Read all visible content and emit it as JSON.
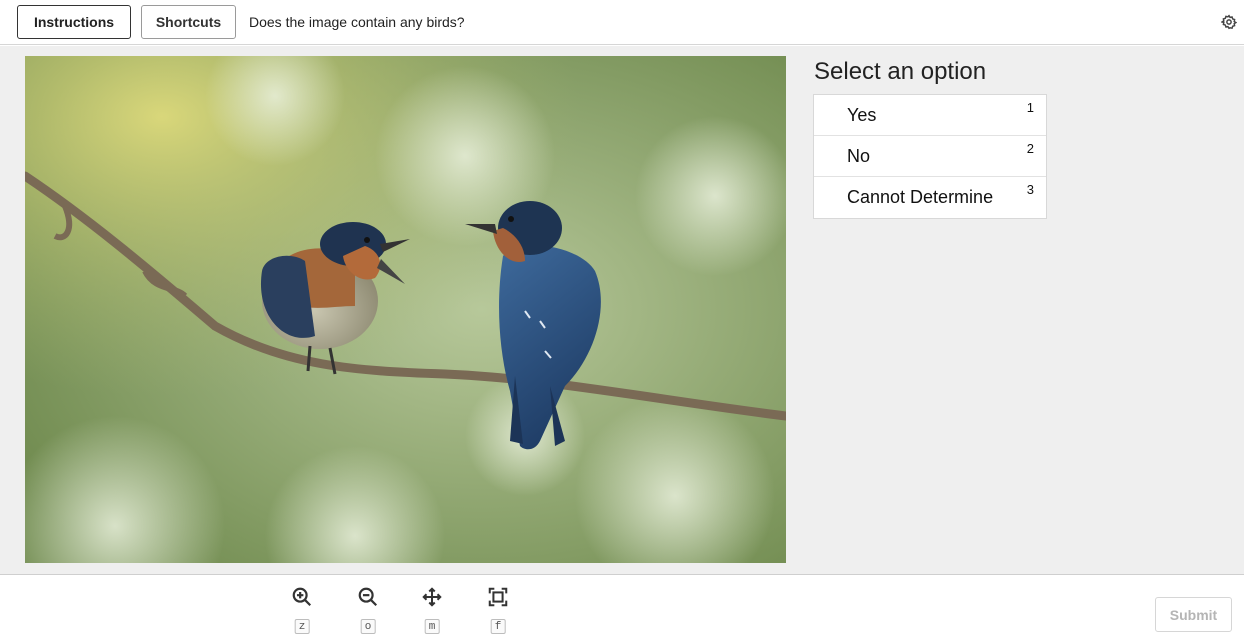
{
  "header": {
    "instructions_label": "Instructions",
    "shortcuts_label": "Shortcuts",
    "question": "Does the image contain any birds?"
  },
  "panel": {
    "title": "Select an option",
    "options": [
      {
        "label": "Yes",
        "key": "1"
      },
      {
        "label": "No",
        "key": "2"
      },
      {
        "label": "Cannot Determine",
        "key": "3"
      }
    ]
  },
  "toolbar": {
    "tools": [
      {
        "icon": "zoom-in-icon",
        "key": "z"
      },
      {
        "icon": "zoom-out-icon",
        "key": "o"
      },
      {
        "icon": "move-icon",
        "key": "m"
      },
      {
        "icon": "fit-screen-icon",
        "key": "f"
      }
    ],
    "submit_label": "Submit"
  },
  "colors": {
    "main_background": "#efefef",
    "submit_disabled_text": "#b5b5b5"
  }
}
